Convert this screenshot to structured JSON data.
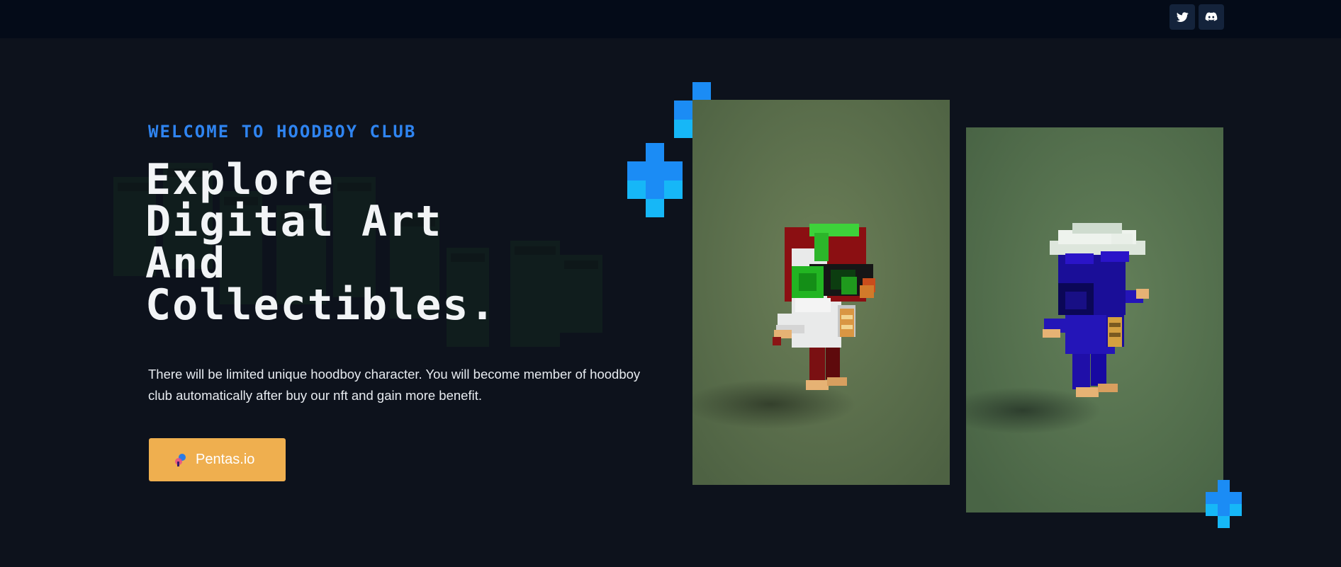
{
  "topbar": {
    "social": [
      {
        "name": "twitter",
        "icon": "twitter-icon"
      },
      {
        "name": "discord",
        "icon": "discord-icon"
      }
    ]
  },
  "hero": {
    "eyebrow": "WELCOME TO HOODBOY CLUB",
    "headline_lines": [
      "Explore",
      "Digital Art",
      "And",
      "Collectibles."
    ],
    "description": "There will be limited unique hoodboy character. You will become member of hoodboy club automatically after buy our nft and gain more benefit.",
    "cta": {
      "label": "Pentas.io",
      "icon": "pentas-logo-icon"
    }
  },
  "gallery": {
    "cards": [
      {
        "name": "hoodboy-red",
        "bg": "#566b48"
      },
      {
        "name": "hoodboy-blue",
        "bg": "#4f6b4a"
      }
    ]
  },
  "colors": {
    "background": "#0d121c",
    "topbar": "#040b18",
    "accent_blue": "#2f84f0",
    "cta": "#efaf4f",
    "plus_dark": "#1b8cf5",
    "plus_light": "#16b7f7"
  }
}
